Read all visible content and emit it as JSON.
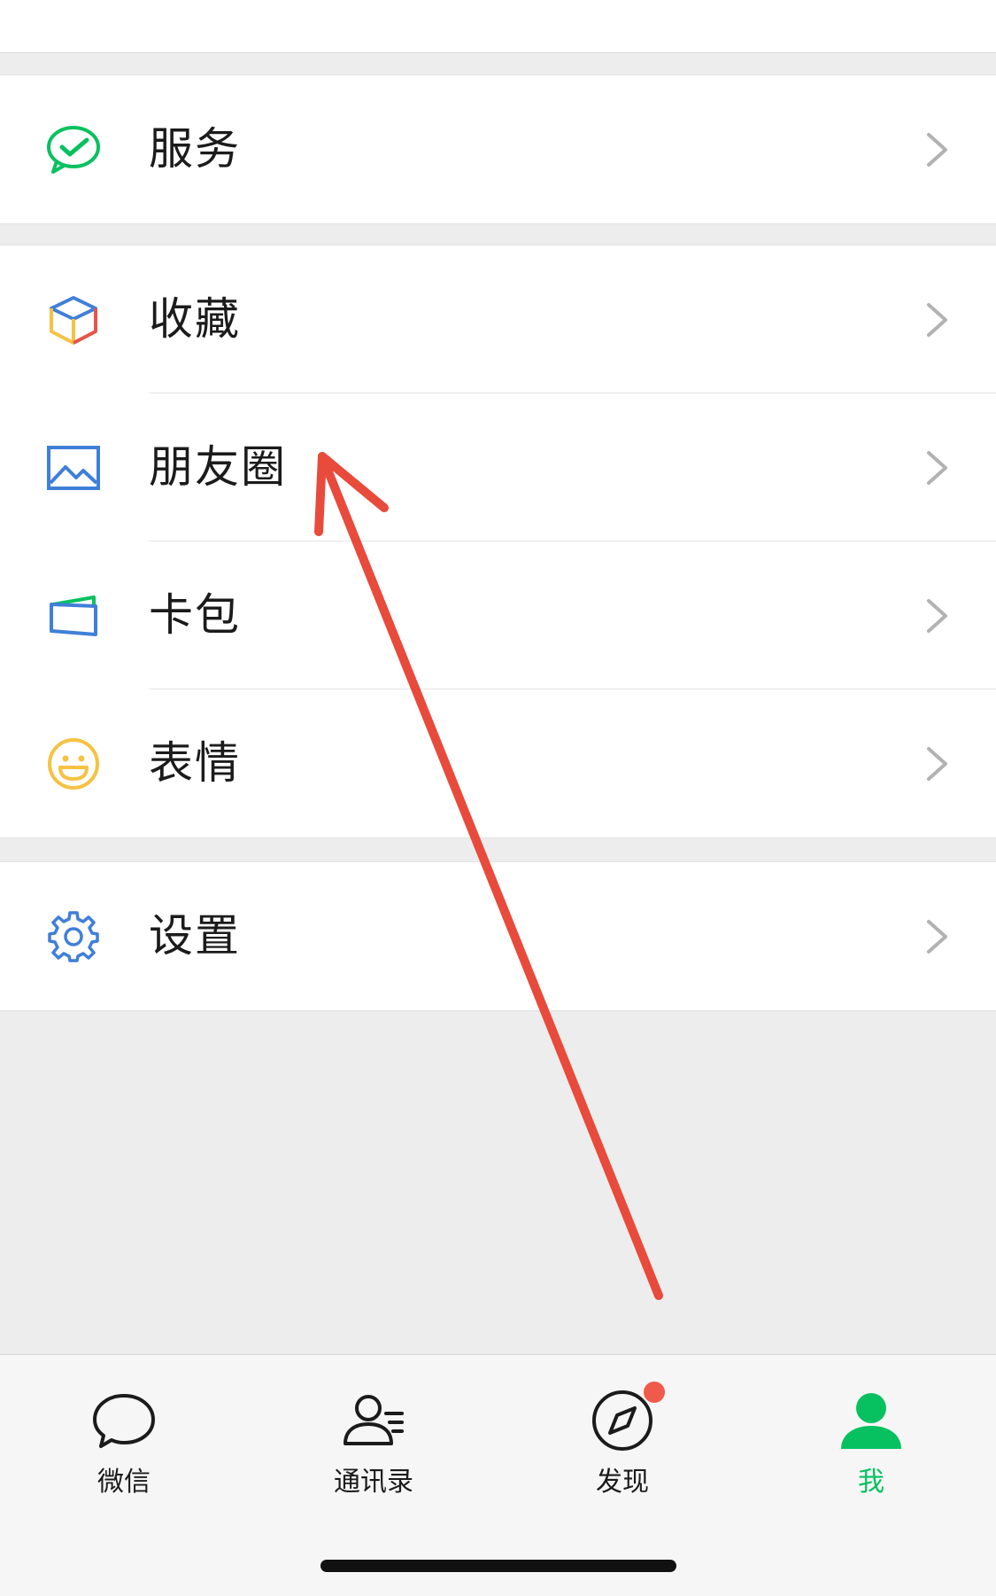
{
  "menu": {
    "services": {
      "label": "服务"
    },
    "favorites": {
      "label": "收藏"
    },
    "moments": {
      "label": "朋友圈"
    },
    "cards": {
      "label": "卡包"
    },
    "stickers": {
      "label": "表情"
    },
    "settings": {
      "label": "设置"
    }
  },
  "tabbar": {
    "chats": {
      "label": "微信",
      "icon": "chat-bubble-icon"
    },
    "contacts": {
      "label": "通讯录",
      "icon": "contacts-icon"
    },
    "discover": {
      "label": "发现",
      "icon": "compass-icon",
      "has_badge_dot": true
    },
    "me": {
      "label": "我",
      "icon": "person-icon",
      "selected": true
    }
  },
  "colors": {
    "accent_green": "#07c160",
    "annotation_arrow": "#e84a3c",
    "badge": "#f05a4a",
    "icon_blue": "#3f7fd9",
    "icon_yellow": "#f5c242"
  },
  "annotation": {
    "type": "arrow",
    "points_to": "朋友圈"
  }
}
